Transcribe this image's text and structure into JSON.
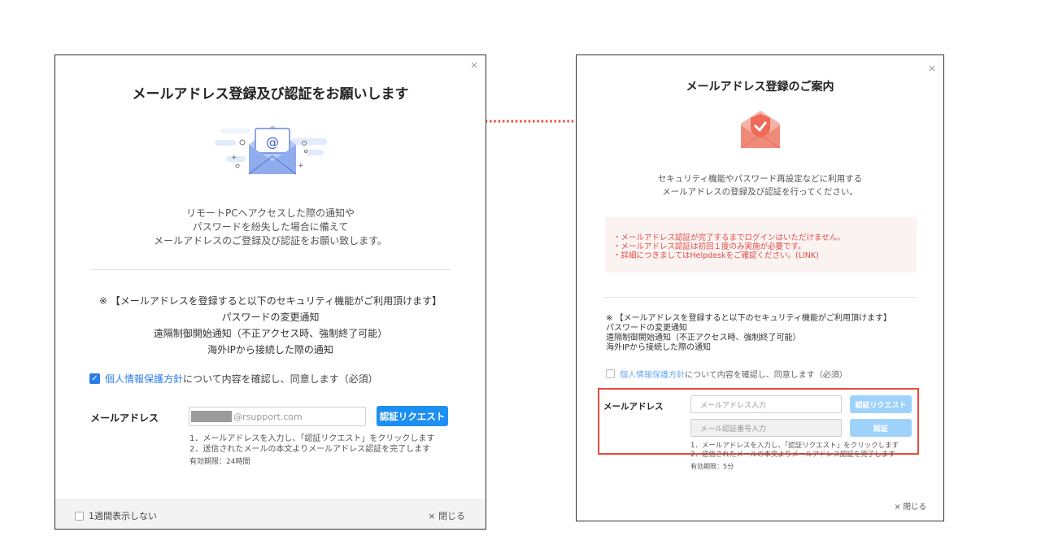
{
  "colors": {
    "accent": "#1e8ff2",
    "accent_disabled": "#9fd2fb",
    "warning_text": "#e54b45",
    "highlight_outline": "#e74c3c",
    "arrow": "#e74c3c"
  },
  "dialog_a": {
    "close_icon": "×",
    "title": "メールアドレス登録及び認証をお願いします",
    "illustration": "envelope-at-icon",
    "intro": "リモートPCへアクセスした際の通知や\nパスワードを紛失した場合に備えて\nメールアドレスのご登録及び認証をお願い致します。",
    "features": "※ 【メールアドレスを登録すると以下のセキュリティ機能がご利用頂けます】\nパスワードの変更通知\n遠隔制御開始通知（不正アクセス時、強制終了可能）\n海外IPから接続した際の通知",
    "agree": {
      "checked": true,
      "link": "個人情報保護方針",
      "rest": "について内容を確認し、同意します（必須）"
    },
    "email_label": "メールアドレス",
    "email_value_domain": "@rsupport.com",
    "request_button": "認証リクエスト",
    "steps": "1．メールアドレスを入力し、「認証リクエスト」をクリックします\n2．送信されたメールの本文よりメールアドレス認証を完了します",
    "validity": "有効期限：24時間",
    "footer": {
      "hide_label": "1週間表示しない",
      "close_label": "× 閉じる"
    }
  },
  "dialog_b": {
    "close_icon": "×",
    "title": "メールアドレス登録のご案内",
    "illustration": "envelope-shield-icon",
    "intro": "セキュリティ機能やパスワード再設定などに利用する\nメールアドレスの登録及び認証を行ってください。",
    "warnings": [
      "・メールアドレス認証が完了するまでログインはいただけません。",
      "・メールアドレス認証は初回１度のみ実施が必要です。",
      "・詳細につきましてはHelpdeskをご確認ください。(LINK)"
    ],
    "features": "※ 【メールアドレスを登録すると以下のセキュリティ機能がご利用頂けます】\nパスワードの変更通知\n遠隔制御開始通知（不正アクセス時、強制終了可能）\n海外IPから接続した際の通知",
    "agree": {
      "checked": false,
      "link": "個人情報保護方針",
      "rest": "について内容を確認し、同意します（必須）"
    },
    "email_label": "メールアドレス",
    "email_placeholder": "メールアドレス入力",
    "request_button": "認証リクエスト",
    "code_placeholder": "メール認証番号入力",
    "verify_button": "認証",
    "steps": "1．メールアドレスを入力し、「認証リクエスト」をクリックします\n2．送信されたメールの本文よりメールアドレス認証を完了します",
    "validity": "有効期限：5分",
    "close_label": "× 閉じる"
  }
}
